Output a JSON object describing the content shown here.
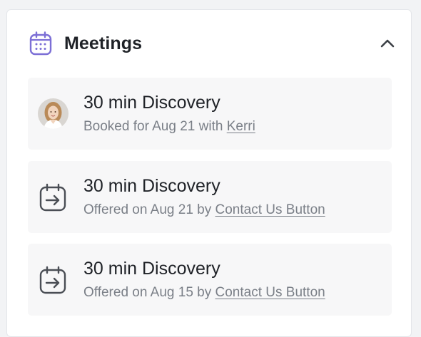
{
  "section": {
    "title": "Meetings",
    "icon": "calendar-icon",
    "collapse_icon": "chevron-up-icon",
    "accent_color": "#7c6fd6"
  },
  "meetings": [
    {
      "title": "30 min Discovery",
      "status_prefix": "Booked for Aug 21 with",
      "link_text": "Kerri",
      "icon": "avatar"
    },
    {
      "title": "30 min Discovery",
      "status_prefix": "Offered on Aug 21 by",
      "link_text": "Contact Us Button",
      "icon": "calendar-arrow-icon"
    },
    {
      "title": "30 min Discovery",
      "status_prefix": "Offered on Aug 15 by",
      "link_text": "Contact Us Button",
      "icon": "calendar-arrow-icon"
    }
  ]
}
